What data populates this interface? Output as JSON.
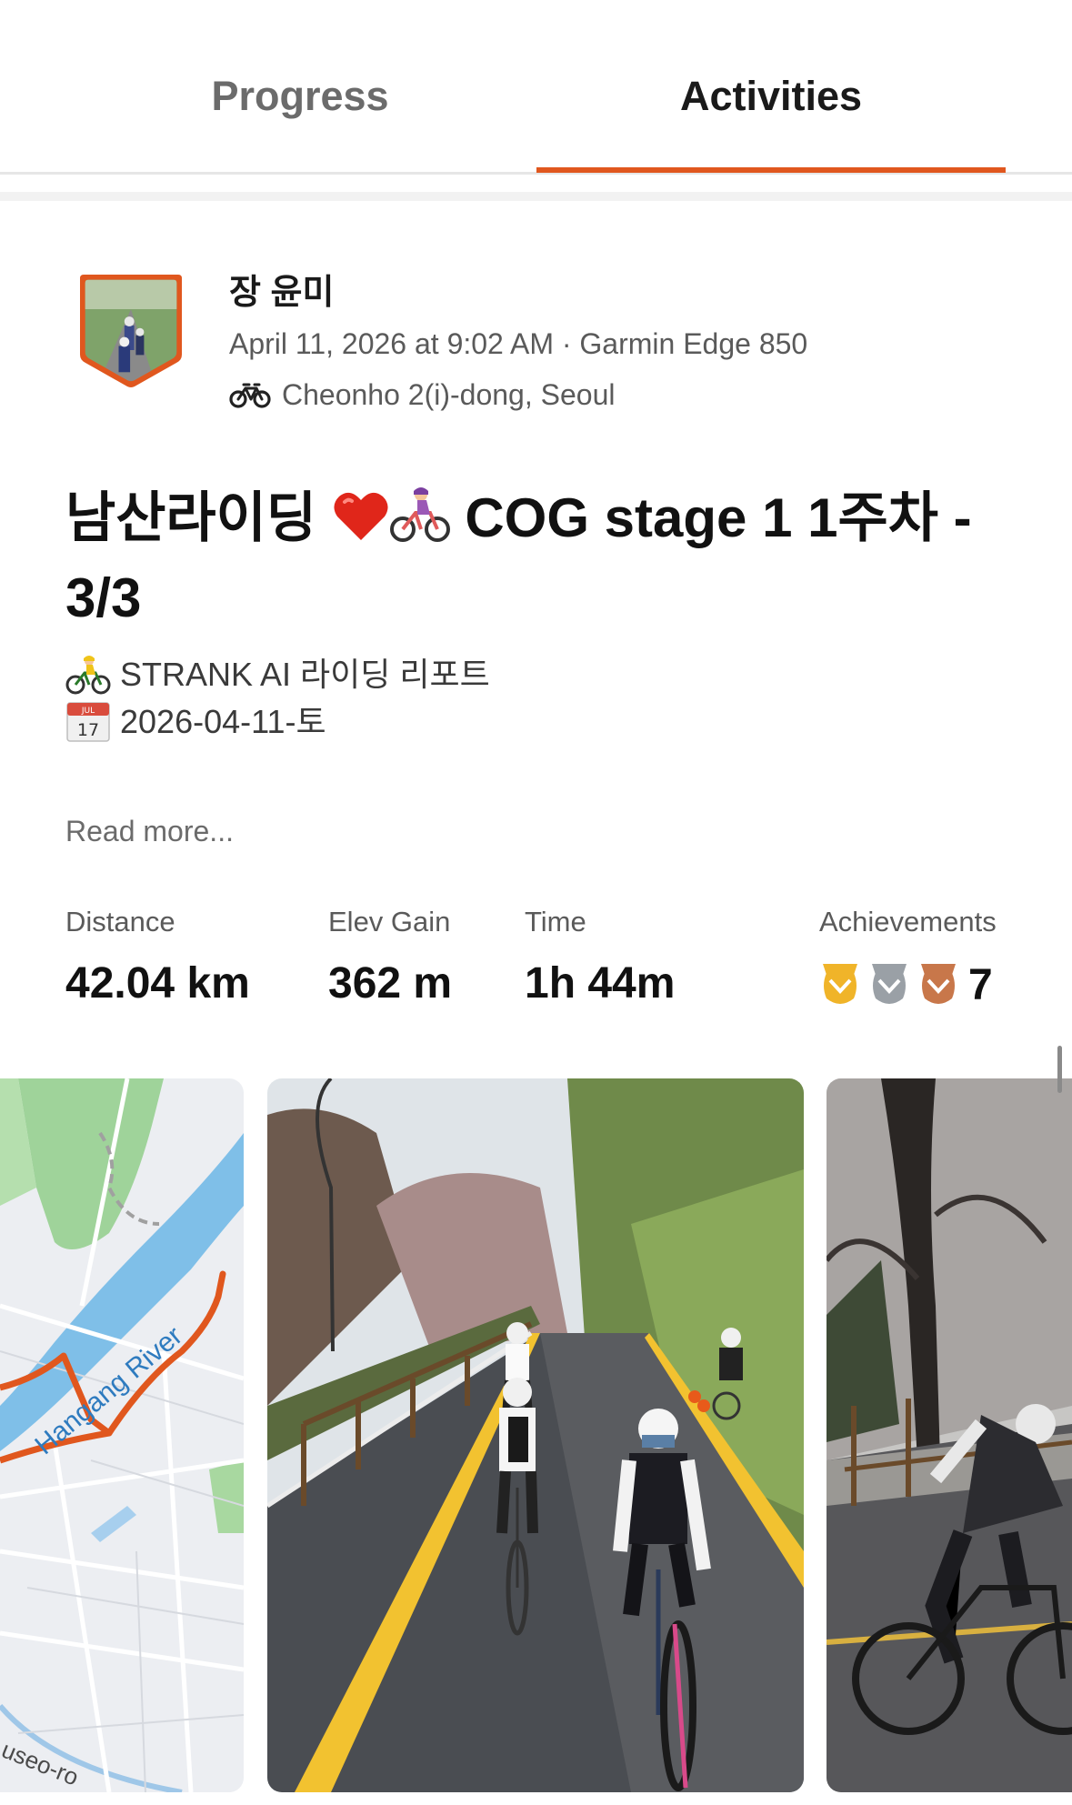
{
  "tabs": {
    "progress_label": "Progress",
    "activities_label": "Activities",
    "active": "Activities"
  },
  "activity": {
    "athlete_name": "장 윤미",
    "date_device": "April 11, 2026 at 9:02 AM · Garmin Edge 850",
    "location": "Cheonho 2(i)-dong, Seoul",
    "title_part1": "남산라이딩",
    "title_part2": "COG stage 1 1주차 - 3/3",
    "desc_line1": "STRANK AI 라이딩 리포트",
    "desc_line2": "2026-04-11-토",
    "calendar_month": "JUL",
    "calendar_day": "17",
    "read_more": "Read more..."
  },
  "stats": {
    "distance_label": "Distance",
    "distance_value": "42.04 km",
    "elev_label": "Elev Gain",
    "elev_value": "362 m",
    "time_label": "Time",
    "time_value": "1h 44m",
    "achievements_label": "Achievements",
    "achievements_count": "7"
  },
  "map": {
    "river_label": "Hangang River",
    "road_label": "useo-ro"
  },
  "colors": {
    "accent": "#e0571e",
    "gold": "#f0b429",
    "silver": "#9aa0a6",
    "bronze": "#c8774a"
  },
  "icons": [
    "bike-icon",
    "heart-emoji",
    "cyclist-emoji",
    "calendar-emoji",
    "gold-medal-icon",
    "silver-medal-icon",
    "bronze-medal-icon"
  ]
}
